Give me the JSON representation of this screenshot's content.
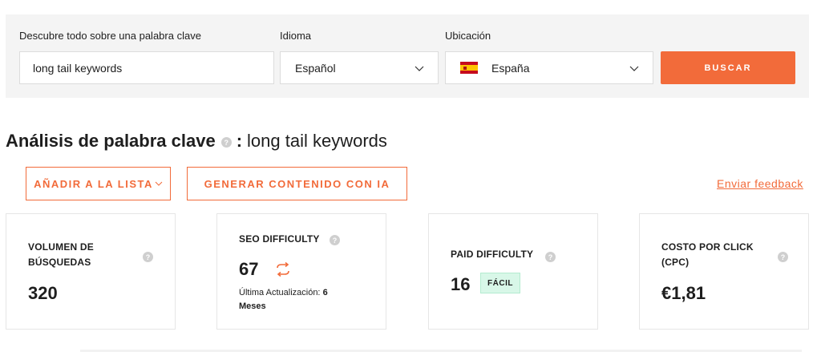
{
  "search": {
    "keyword_label": "Descubre todo sobre una palabra clave",
    "keyword_value": "long tail keywords",
    "language_label": "Idioma",
    "language_value": "Español",
    "location_label": "Ubicación",
    "location_value": "España",
    "search_button": "BUSCAR"
  },
  "analysis": {
    "title": "Análisis de palabra clave",
    "separator": ":",
    "keyword": "long tail keywords",
    "help_icon": "question-icon"
  },
  "actions": {
    "add_to_list": "AÑADIR A LA LISTA",
    "generate_ai": "GENERAR CONTENIDO CON IA",
    "feedback": "Enviar feedback"
  },
  "metrics": {
    "volume": {
      "label_line1": "VOLUMEN DE",
      "label_line2": "BÚSQUEDAS",
      "value": "320"
    },
    "seo": {
      "label": "SEO DIFFICULTY",
      "value": "67",
      "updated_prefix": "Última Actualización:",
      "updated_value": "6",
      "updated_unit": "Meses"
    },
    "paid": {
      "label": "PAID DIFFICULTY",
      "value": "16",
      "badge": "FÁCIL"
    },
    "cpc": {
      "label_line1": "COSTO POR CLICK",
      "label_line2": "(CPC)",
      "value": "€1,81"
    }
  },
  "colors": {
    "accent": "#f26b3a",
    "panel_bg": "#f4f4f4",
    "badge_bg": "#d8f7e8"
  },
  "icons": {
    "help": "?",
    "dropdown": "chevron-down-icon",
    "flag": "spain-flag-icon",
    "refresh": "refresh-icon"
  }
}
